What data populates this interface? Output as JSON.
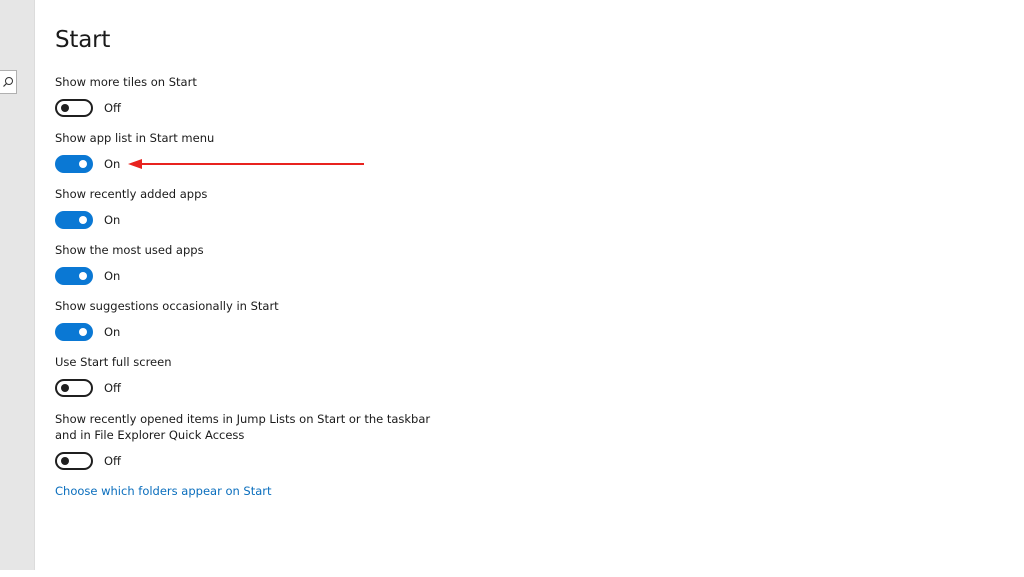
{
  "page": {
    "title": "Start"
  },
  "settings": [
    {
      "label": "Show more tiles on Start",
      "state": "Off",
      "on": false
    },
    {
      "label": "Show app list in Start menu",
      "state": "On",
      "on": true
    },
    {
      "label": "Show recently added apps",
      "state": "On",
      "on": true
    },
    {
      "label": "Show the most used apps",
      "state": "On",
      "on": true
    },
    {
      "label": "Show suggestions occasionally in Start",
      "state": "On",
      "on": true
    },
    {
      "label": "Use Start full screen",
      "state": "Off",
      "on": false
    },
    {
      "label": "Show recently opened items in Jump Lists on Start or the taskbar and in File Explorer Quick Access",
      "state": "Off",
      "on": false
    }
  ],
  "links": {
    "folders": "Choose which folders appear on Start"
  },
  "icons": {
    "search": "search-icon",
    "annotation": "red-arrow-annotation"
  },
  "colors": {
    "accent": "#0a78d4",
    "link": "#0a6ebd",
    "annotation": "#e8231f",
    "sidebar": "#e6e6e6"
  }
}
